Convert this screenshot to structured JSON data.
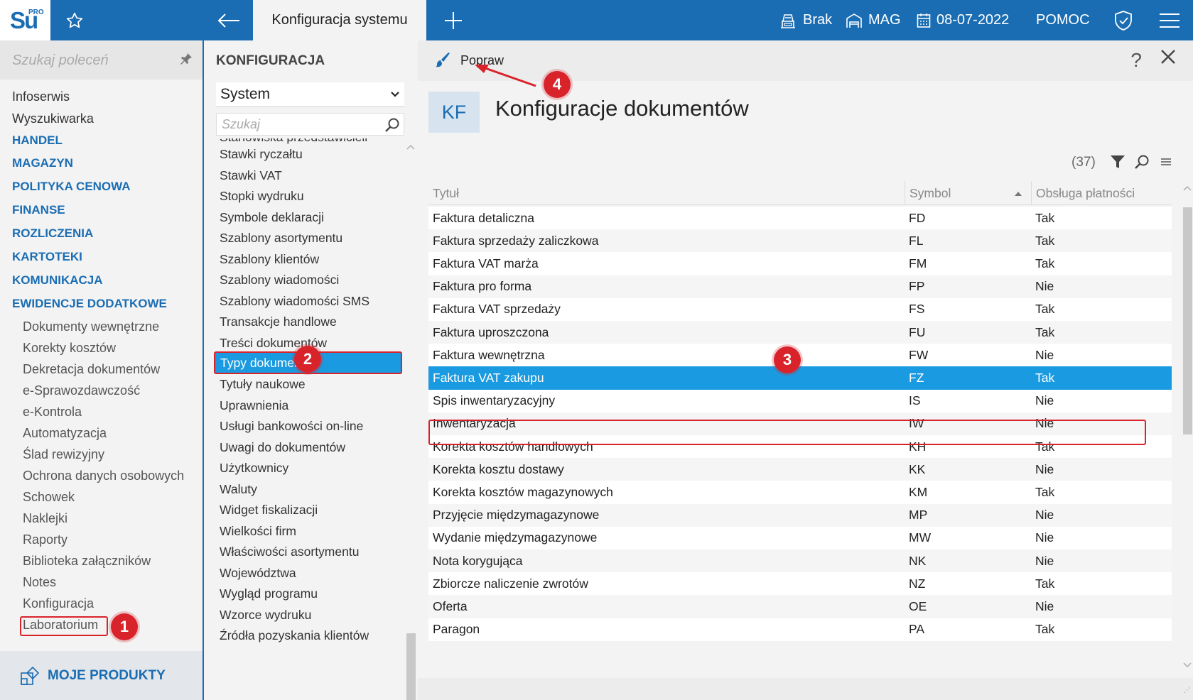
{
  "app": {
    "logo_text": "Su",
    "logo_badge": "PRO",
    "active_tab": "Konfiguracja systemu",
    "status_items": {
      "cash": "Brak",
      "warehouse": "MAG",
      "date": "08-07-2022",
      "help": "POMOC"
    }
  },
  "sidebar": {
    "search_placeholder": "Szukaj poleceń",
    "top_items": [
      "Infoserwis",
      "Wyszukiwarka"
    ],
    "sections": [
      "HANDEL",
      "MAGAZYN",
      "POLITYKA CENOWA",
      "FINANSE",
      "ROZLICZENIA",
      "KARTOTEKI",
      "KOMUNIKACJA",
      "EWIDENCJE DODATKOWE"
    ],
    "sub_items": [
      "Dokumenty wewnętrzne",
      "Korekty kosztów",
      "Dekretacja dokumentów",
      "e-Sprawozdawczość",
      "e-Kontrola",
      "Automatyzacja",
      "Ślad rewizyjny",
      "Ochrona danych osobowych",
      "Schowek",
      "Naklejki",
      "Raporty",
      "Biblioteka załączników",
      "Notes",
      "Konfiguracja",
      "Laboratorium"
    ],
    "my_products": "MOJE PRODUKTY"
  },
  "config": {
    "title": "KONFIGURACJA",
    "select_value": "System",
    "search_placeholder": "Szukaj",
    "items": [
      "Stanowiska przedstawicieli",
      "Stawki ryczałtu",
      "Stawki VAT",
      "Stopki wydruku",
      "Symbole deklaracji",
      "Szablony asortymentu",
      "Szablony klientów",
      "Szablony wiadomości",
      "Szablony wiadomości SMS",
      "Transakcje handlowe",
      "Treści dokumentów",
      "Typy dokumentów",
      "Tytuły naukowe",
      "Uprawnienia",
      "Usługi bankowości on-line",
      "Uwagi do dokumentów",
      "Użytkownicy",
      "Waluty",
      "Widget fiskalizacji",
      "Wielkości firm",
      "Właściwości asortymentu",
      "Województwa",
      "Wygląd programu",
      "Wzorce wydruku",
      "Źródła pozyskania klientów"
    ],
    "selected_item": "Typy dokumentów"
  },
  "main": {
    "edit_button": "Popraw",
    "help_label": "?",
    "badge": "KF",
    "heading": "Konfiguracje dokumentów",
    "count": "(37)",
    "columns": [
      "Tytuł",
      "Symbol",
      "Obsługa płatności"
    ],
    "rows": [
      [
        "Faktura detaliczna",
        "FD",
        "Tak"
      ],
      [
        "Faktura sprzedaży zaliczkowa",
        "FL",
        "Tak"
      ],
      [
        "Faktura VAT marża",
        "FM",
        "Tak"
      ],
      [
        "Faktura pro forma",
        "FP",
        "Nie"
      ],
      [
        "Faktura VAT sprzedaży",
        "FS",
        "Tak"
      ],
      [
        "Faktura uproszczona",
        "FU",
        "Tak"
      ],
      [
        "Faktura wewnętrzna",
        "FW",
        "Nie"
      ],
      [
        "Faktura VAT zakupu",
        "FZ",
        "Tak"
      ],
      [
        "Spis inwentaryzacyjny",
        "IS",
        "Nie"
      ],
      [
        "Inwentaryzacja",
        "IW",
        "Nie"
      ],
      [
        "Korekta kosztów handlowych",
        "KH",
        "Tak"
      ],
      [
        "Korekta kosztu dostawy",
        "KK",
        "Nie"
      ],
      [
        "Korekta kosztów magazynowych",
        "KM",
        "Tak"
      ],
      [
        "Przyjęcie międzymagazynowe",
        "MP",
        "Nie"
      ],
      [
        "Wydanie międzymagazynowe",
        "MW",
        "Nie"
      ],
      [
        "Nota korygująca",
        "NK",
        "Nie"
      ],
      [
        "Zbiorcze naliczenie zwrotów",
        "NZ",
        "Tak"
      ],
      [
        "Oferta",
        "OE",
        "Nie"
      ],
      [
        "Paragon",
        "PA",
        "Tak"
      ]
    ],
    "selected_row_symbol": "FZ"
  },
  "callouts": [
    "1",
    "2",
    "3",
    "4"
  ],
  "colors": {
    "brand": "#1a6db3",
    "selection": "#1a9ae0",
    "annotation": "#d9232b"
  }
}
